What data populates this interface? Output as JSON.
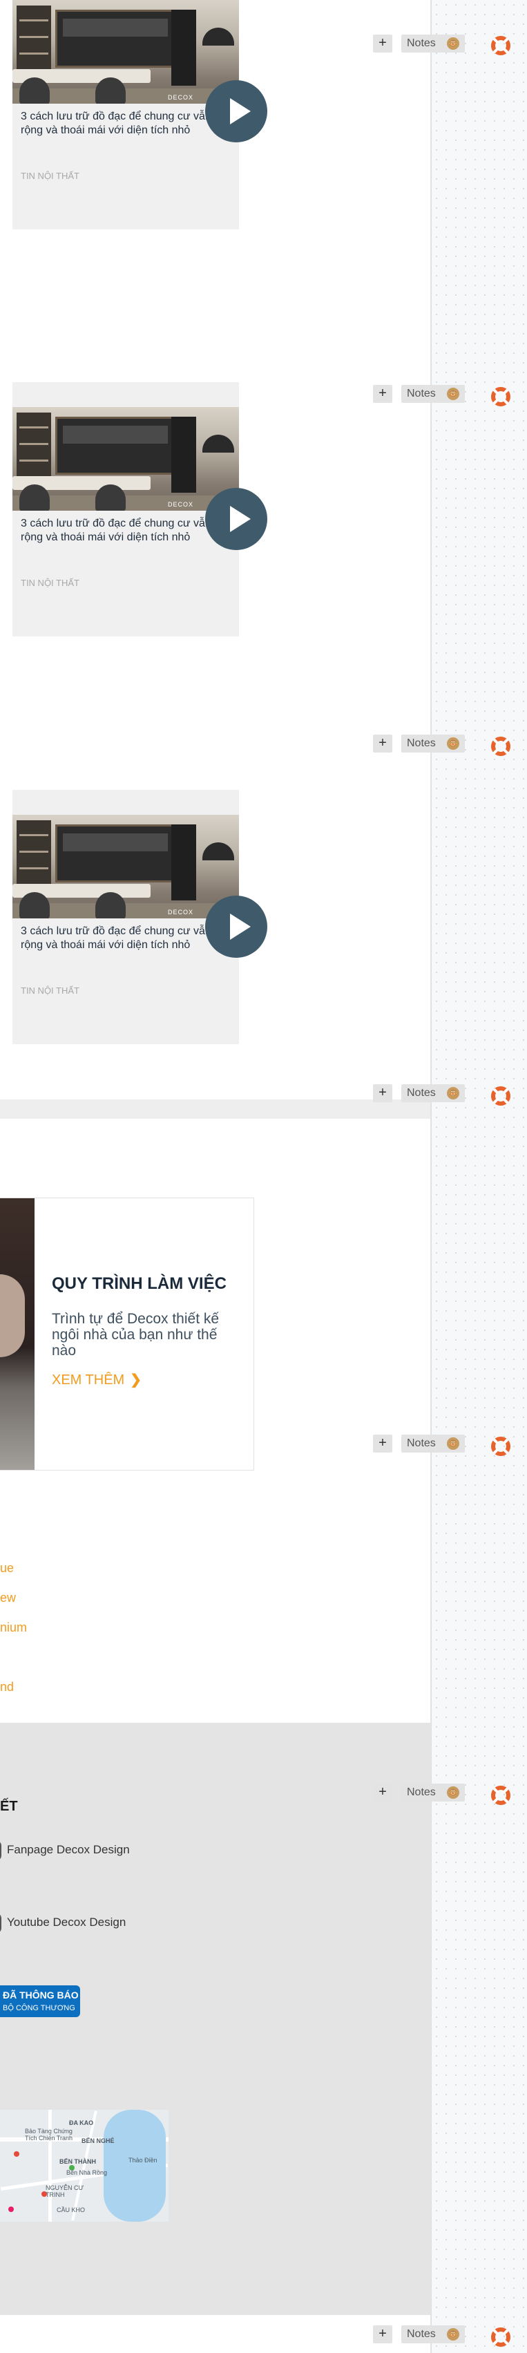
{
  "articles": [
    {
      "title": "3 cách lưu trữ đồ đạc để chung cư vẫn rộng và thoái mái với diện tích nhỏ",
      "category": "TIN NỘI THẤT",
      "brand": "DECOX"
    },
    {
      "title": "3 cách lưu trữ đồ đạc để chung cư vẫn rộng và thoái mái với diện tích nhỏ",
      "category": "TIN NỘI THẤT",
      "brand": "DECOX"
    },
    {
      "title": "3 cách lưu trữ đồ đạc để chung cư vẫn rộng và thoái mái với diện tích nhỏ",
      "category": "TIN NỘI THẤT",
      "brand": "DECOX"
    }
  ],
  "tools": {
    "plus_label": "+",
    "notes_label": "Notes",
    "face_glyph": "🐵"
  },
  "process": {
    "title": "QUY TRÌNH LÀM VIỆC",
    "description": "Trình tự để Decox thiết kế ngôi nhà của bạn như thế nào",
    "more_label": "XEM THÊM",
    "more_chevron": "❯"
  },
  "links": [
    "ue",
    "ew",
    "nium",
    "nd"
  ],
  "footer": {
    "heading": "ẾT",
    "social": [
      "Fanpage Decox Design",
      "Youtube Decox Design"
    ],
    "badge_line1": "ĐÃ THÔNG BÁO",
    "badge_line2": "BỘ CÔNG THƯƠNG",
    "map_labels": [
      "ĐA KAO",
      "BẾN THÀNH",
      "Bến Nhà Rồng",
      "NGUYỄN CƯ TRINH",
      "Bảo Tàng Chứng Tích Chiến Tranh",
      "BẾN NGHÉ",
      "Thảo Điền",
      "CẦU KHO"
    ]
  },
  "colors": {
    "accent": "#f29c1f",
    "play_button": "#3f5b6b",
    "lifebuoy": "#e8632b",
    "gov_badge": "#0d6fc0"
  }
}
